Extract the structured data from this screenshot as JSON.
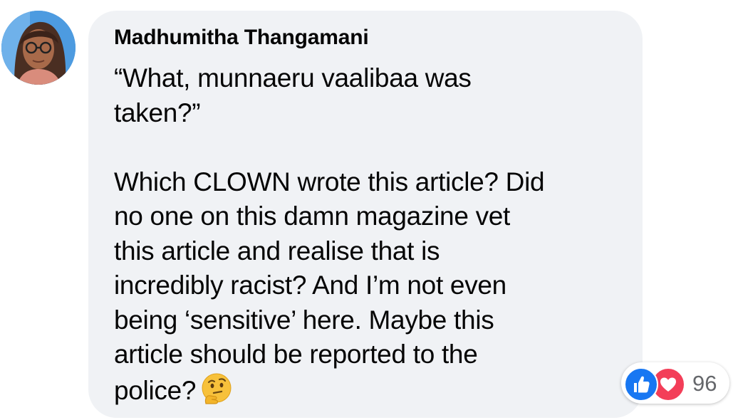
{
  "comment": {
    "author": "Madhumitha Thangamani",
    "lines": [
      "“What, munnaeru vaalibaa was",
      "taken?”",
      "",
      "Which CLOWN wrote this article? Did",
      "no one on this damn magazine vet",
      "this article and realise that is",
      "incredibly racist? And I’m not even",
      "being ‘sensitive’ here. Maybe this",
      "article should be reported to the",
      "police?"
    ],
    "emoji": "thinking-face"
  },
  "reactions": {
    "types": [
      "like",
      "love"
    ],
    "count": "96"
  },
  "colors": {
    "bubble": "#f0f2f5",
    "text": "#050505",
    "like": "#1877f2",
    "love": "#f33e58",
    "count": "#65676b"
  }
}
